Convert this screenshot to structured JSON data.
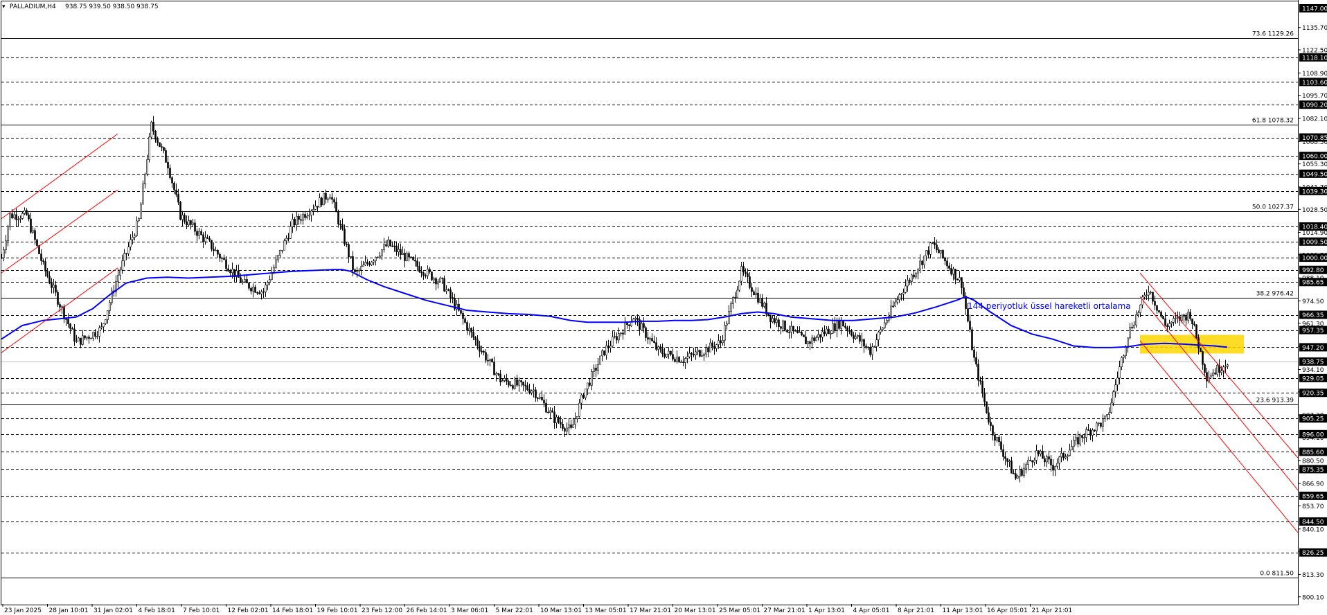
{
  "header": {
    "arrow_glyph": "▾",
    "symbol_label": "PALLADIUM,H4",
    "ohlc_text": "938.75 939.50 938.50 938.75"
  },
  "annotation": {
    "ema_label": "144 periyotluk üssel hareketli ortalama"
  },
  "colors": {
    "bull_candle": "#000000",
    "bear_candle": "#000000",
    "ema_line": "#0000ff",
    "channel_lines": "#ff0000",
    "highlight_zone": "#ffd700",
    "price_marker_bg": "#000000",
    "grid": "#000000"
  },
  "chart_data": {
    "type": "candlestick",
    "ylim": [
      800.0,
      1147.0
    ],
    "y_ticks": [
      "1135.70",
      "1122.50",
      "1108.90",
      "1095.70",
      "1082.10",
      "1068.50",
      "1055.30",
      "1041.70",
      "1028.50",
      "1014.90",
      "1001.70",
      "988.10",
      "974.50",
      "961.30",
      "947.70",
      "934.10",
      "920.90",
      "907.30",
      "894.10",
      "880.50",
      "866.90",
      "853.70",
      "840.10",
      "826.90",
      "813.30",
      "800.10"
    ],
    "price_markers": [
      "1147.00",
      "1118.10",
      "1103.60",
      "1090.20",
      "1070.85",
      "1060.00",
      "1049.50",
      "1039.30",
      "1018.40",
      "1009.50",
      "1000.00",
      "992.80",
      "985.65",
      "966.35",
      "957.35",
      "947.20",
      "938.75",
      "929.05",
      "920.35",
      "905.25",
      "896.00",
      "885.60",
      "875.35",
      "859.65",
      "844.50",
      "826.25"
    ],
    "fib_levels": [
      {
        "label": "73.6 1129.26",
        "price": 1129.26
      },
      {
        "label": "61.8 1078.32",
        "price": 1078.32
      },
      {
        "label": "50.0 1027.37",
        "price": 1027.37
      },
      {
        "label": "38.2 976.42",
        "price": 976.42
      },
      {
        "label": "23.6 913.39",
        "price": 913.39
      },
      {
        "label": "0.0 811.50",
        "price": 811.5
      }
    ],
    "dashed_levels": [
      1118.1,
      1103.6,
      1090.2,
      1070.85,
      1060.0,
      1049.5,
      1039.3,
      1018.4,
      1009.5,
      1000.0,
      992.8,
      985.65,
      966.35,
      957.35,
      947.2,
      929.05,
      920.35,
      905.25,
      896.0,
      885.6,
      875.35,
      859.65,
      844.5,
      826.25
    ],
    "current_price": 938.75,
    "x_labels": [
      "23 Jan 2025",
      "28 Jan 10:01",
      "31 Jan 02:01",
      "4 Feb 18:01",
      "7 Feb 10:01",
      "12 Feb 02:01",
      "14 Feb 18:01",
      "19 Feb 10:01",
      "23 Feb 12:00",
      "26 Feb 14:01",
      "3 Mar 06:01",
      "5 Mar 22:01",
      "10 Mar 13:01",
      "13 Mar 05:01",
      "17 Mar 21:01",
      "20 Mar 13:01",
      "25 Mar 05:01",
      "27 Mar 21:01",
      "1 Apr 13:01",
      "4 Apr 05:01",
      "8 Apr 21:01",
      "11 Apr 13:01",
      "16 Apr 05:01",
      "21 Apr 21:01"
    ],
    "close_path": [
      [
        0,
        1020
      ],
      [
        6,
        1028
      ],
      [
        10,
        1025
      ],
      [
        16,
        1003
      ],
      [
        24,
        985
      ],
      [
        32,
        970
      ],
      [
        40,
        962
      ],
      [
        46,
        958
      ],
      [
        52,
        965
      ],
      [
        58,
        980
      ],
      [
        64,
        1005
      ],
      [
        68,
        1030
      ],
      [
        70,
        1060
      ],
      [
        72,
        1072
      ],
      [
        76,
        1062
      ],
      [
        80,
        1050
      ],
      [
        84,
        1030
      ],
      [
        88,
        1010
      ],
      [
        94,
        1008
      ],
      [
        100,
        1012
      ],
      [
        106,
        998
      ],
      [
        112,
        992
      ],
      [
        118,
        986
      ],
      [
        124,
        984
      ],
      [
        130,
        1000
      ],
      [
        136,
        995
      ],
      [
        142,
        985
      ],
      [
        146,
        983
      ],
      [
        150,
        998
      ],
      [
        154,
        1018
      ],
      [
        158,
        1035
      ],
      [
        162,
        1025
      ],
      [
        166,
        1000
      ],
      [
        170,
        992
      ],
      [
        176,
        995
      ],
      [
        182,
        1002
      ],
      [
        188,
        998
      ],
      [
        194,
        1002
      ],
      [
        200,
        995
      ],
      [
        206,
        1003
      ],
      [
        212,
        995
      ],
      [
        218,
        988
      ],
      [
        224,
        978
      ],
      [
        230,
        965
      ],
      [
        236,
        952
      ],
      [
        242,
        940
      ],
      [
        248,
        932
      ],
      [
        254,
        928
      ],
      [
        260,
        920
      ],
      [
        266,
        910
      ],
      [
        272,
        906
      ],
      [
        278,
        915
      ],
      [
        282,
        925
      ],
      [
        286,
        940
      ],
      [
        292,
        950
      ],
      [
        298,
        955
      ],
      [
        304,
        960
      ],
      [
        310,
        958
      ],
      [
        316,
        955
      ],
      [
        322,
        950
      ],
      [
        328,
        952
      ],
      [
        334,
        948
      ],
      [
        340,
        945
      ],
      [
        346,
        948
      ],
      [
        350,
        960
      ],
      [
        354,
        978
      ],
      [
        358,
        982
      ],
      [
        362,
        980
      ],
      [
        368,
        975
      ],
      [
        374,
        970
      ],
      [
        380,
        965
      ],
      [
        386,
        955
      ],
      [
        390,
        948
      ],
      [
        396,
        952
      ],
      [
        402,
        960
      ],
      [
        408,
        958
      ],
      [
        414,
        955
      ],
      [
        420,
        958
      ],
      [
        424,
        962
      ],
      [
        428,
        972
      ],
      [
        432,
        985
      ],
      [
        438,
        992
      ],
      [
        444,
        1000
      ],
      [
        450,
        1005
      ],
      [
        456,
        1000
      ],
      [
        462,
        990
      ],
      [
        466,
        975
      ],
      [
        468,
        960
      ],
      [
        470,
        940
      ],
      [
        474,
        925
      ],
      [
        480,
        910
      ],
      [
        486,
        898
      ],
      [
        492,
        890
      ],
      [
        498,
        885
      ],
      [
        504,
        888
      ],
      [
        510,
        880
      ],
      [
        516,
        890
      ],
      [
        522,
        900
      ],
      [
        528,
        905
      ],
      [
        534,
        915
      ],
      [
        538,
        935
      ],
      [
        542,
        958
      ],
      [
        546,
        975
      ],
      [
        550,
        982
      ],
      [
        554,
        978
      ],
      [
        558,
        970
      ],
      [
        562,
        962
      ],
      [
        566,
        960
      ],
      [
        570,
        958
      ],
      [
        574,
        963
      ],
      [
        578,
        965
      ],
      [
        580,
        948
      ],
      [
        582,
        935
      ],
      [
        584,
        930
      ],
      [
        586,
        935
      ],
      [
        590,
        938.75
      ]
    ],
    "ema_144_path": [
      [
        0,
        952
      ],
      [
        10,
        960
      ],
      [
        20,
        963
      ],
      [
        28,
        964
      ],
      [
        36,
        965
      ],
      [
        44,
        970
      ],
      [
        52,
        978
      ],
      [
        60,
        985
      ],
      [
        70,
        988
      ],
      [
        80,
        988.5
      ],
      [
        90,
        988
      ],
      [
        100,
        988.5
      ],
      [
        110,
        989
      ],
      [
        120,
        990
      ],
      [
        130,
        991
      ],
      [
        140,
        992
      ],
      [
        150,
        992.5
      ],
      [
        160,
        993
      ],
      [
        164,
        993
      ],
      [
        168,
        992
      ],
      [
        176,
        987
      ],
      [
        184,
        983
      ],
      [
        194,
        979
      ],
      [
        204,
        975
      ],
      [
        214,
        972
      ],
      [
        224,
        969
      ],
      [
        234,
        968
      ],
      [
        244,
        967
      ],
      [
        254,
        966.5
      ],
      [
        264,
        965.5
      ],
      [
        274,
        963
      ],
      [
        282,
        962
      ],
      [
        290,
        962
      ],
      [
        300,
        962
      ],
      [
        308,
        962.5
      ],
      [
        316,
        962.5
      ],
      [
        324,
        963
      ],
      [
        332,
        963
      ],
      [
        340,
        963.5
      ],
      [
        348,
        965
      ],
      [
        356,
        967
      ],
      [
        364,
        968
      ],
      [
        372,
        967
      ],
      [
        380,
        965
      ],
      [
        390,
        964
      ],
      [
        400,
        963
      ],
      [
        410,
        963
      ],
      [
        420,
        964
      ],
      [
        430,
        965
      ],
      [
        440,
        967.5
      ],
      [
        450,
        971
      ],
      [
        460,
        975
      ],
      [
        464,
        977
      ],
      [
        468,
        975
      ],
      [
        476,
        968
      ],
      [
        486,
        960
      ],
      [
        496,
        955
      ],
      [
        506,
        952
      ],
      [
        516,
        948
      ],
      [
        526,
        947
      ],
      [
        534,
        947
      ],
      [
        542,
        947.5
      ],
      [
        550,
        949
      ],
      [
        560,
        949.5
      ],
      [
        570,
        949
      ],
      [
        576,
        948.5
      ],
      [
        584,
        948
      ],
      [
        590,
        947.2
      ]
    ],
    "channels": [
      {
        "name": "",
        "points": [
          [
            0,
            1023
          ],
          [
            56,
            1073
          ]
        ]
      },
      {
        "name": "",
        "points": [
          [
            0,
            991
          ],
          [
            56,
            1040
          ]
        ]
      },
      {
        "name": "",
        "points": [
          [
            0,
            944
          ],
          [
            56,
            994
          ]
        ]
      },
      {
        "name": "",
        "points": [
          [
            548,
            991
          ],
          [
            624,
            882
          ]
        ]
      },
      {
        "name": "",
        "points": [
          [
            548,
            977
          ],
          [
            624,
            863
          ]
        ]
      },
      {
        "name": "",
        "points": [
          [
            548,
            951
          ],
          [
            624,
            838
          ]
        ]
      }
    ],
    "highlight_zone": {
      "x0": 548,
      "x1": 598,
      "y_low": 943.5,
      "y_high": 954.5
    },
    "swings": [
      [
        0,
        1000
      ],
      [
        4,
        1025
      ],
      [
        12,
        1025
      ],
      [
        20,
        995
      ],
      [
        36,
        950
      ],
      [
        48,
        958
      ],
      [
        56,
        990
      ],
      [
        66,
        1022
      ],
      [
        72,
        1078
      ],
      [
        80,
        1055
      ],
      [
        86,
        1025
      ],
      [
        100,
        1008
      ],
      [
        116,
        985
      ],
      [
        126,
        980
      ],
      [
        140,
        1020
      ],
      [
        158,
        1038
      ],
      [
        170,
        990
      ],
      [
        186,
        1008
      ],
      [
        200,
        995
      ],
      [
        212,
        985
      ],
      [
        226,
        955
      ],
      [
        240,
        928
      ],
      [
        256,
        922
      ],
      [
        266,
        905
      ],
      [
        274,
        898
      ],
      [
        280,
        920
      ],
      [
        290,
        945
      ],
      [
        304,
        965
      ],
      [
        316,
        945
      ],
      [
        328,
        940
      ],
      [
        346,
        950
      ],
      [
        356,
        992
      ],
      [
        370,
        965
      ],
      [
        388,
        950
      ],
      [
        404,
        962
      ],
      [
        418,
        945
      ],
      [
        432,
        978
      ],
      [
        448,
        1008
      ],
      [
        462,
        985
      ],
      [
        468,
        940
      ],
      [
        476,
        900
      ],
      [
        488,
        870
      ],
      [
        498,
        885
      ],
      [
        506,
        877
      ],
      [
        520,
        895
      ],
      [
        532,
        905
      ],
      [
        542,
        955
      ],
      [
        552,
        982
      ],
      [
        560,
        960
      ],
      [
        572,
        967
      ],
      [
        580,
        930
      ],
      [
        586,
        935
      ],
      [
        590,
        939
      ]
    ]
  }
}
